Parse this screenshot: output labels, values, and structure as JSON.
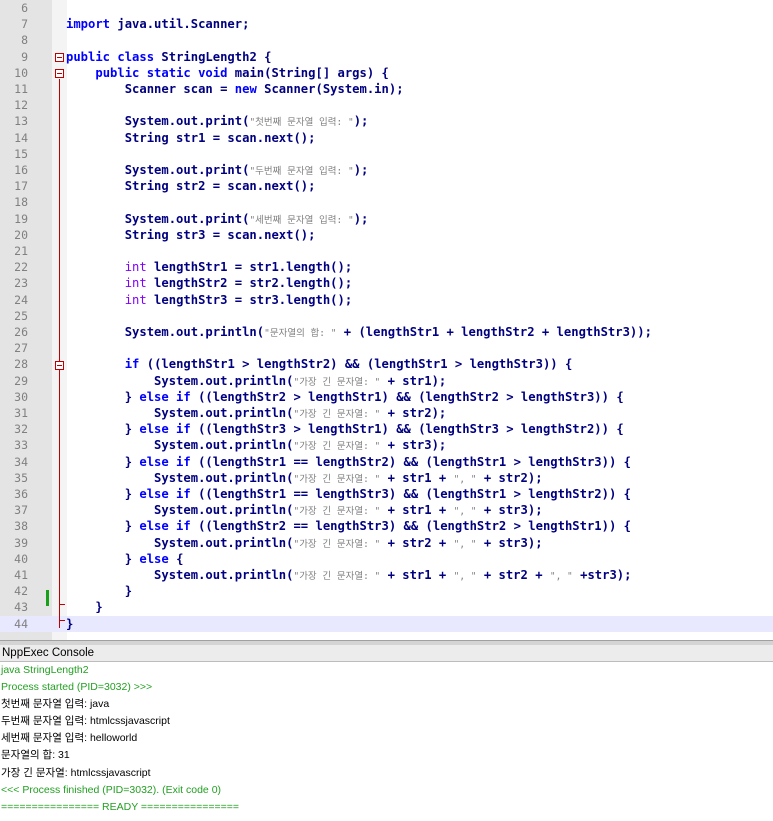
{
  "editor": {
    "lines": [
      {
        "num": "6",
        "segs": []
      },
      {
        "num": "7",
        "segs": [
          {
            "c": "kw",
            "t": "import"
          },
          {
            "c": "",
            "t": " java.util.Scanner;"
          }
        ]
      },
      {
        "num": "8",
        "segs": []
      },
      {
        "num": "9",
        "segs": [
          {
            "c": "kw",
            "t": "public class"
          },
          {
            "c": "",
            "t": " StringLength2 {"
          }
        ]
      },
      {
        "num": "10",
        "segs": [
          {
            "c": "",
            "t": "    "
          },
          {
            "c": "kw",
            "t": "public static void"
          },
          {
            "c": "",
            "t": " main(String[] args) {"
          }
        ]
      },
      {
        "num": "11",
        "segs": [
          {
            "c": "",
            "t": "        Scanner scan = "
          },
          {
            "c": "kw",
            "t": "new"
          },
          {
            "c": "",
            "t": " Scanner(System.in);"
          }
        ]
      },
      {
        "num": "12",
        "segs": []
      },
      {
        "num": "13",
        "segs": [
          {
            "c": "",
            "t": "        System.out.print("
          },
          {
            "c": "str",
            "t": "\"첫번째 문자열 입력: \""
          },
          {
            "c": "",
            "t": ");"
          }
        ]
      },
      {
        "num": "14",
        "segs": [
          {
            "c": "",
            "t": "        String str1 = scan.next();"
          }
        ]
      },
      {
        "num": "15",
        "segs": []
      },
      {
        "num": "16",
        "segs": [
          {
            "c": "",
            "t": "        System.out.print("
          },
          {
            "c": "str",
            "t": "\"두번째 문자열 입력: \""
          },
          {
            "c": "",
            "t": ");"
          }
        ]
      },
      {
        "num": "17",
        "segs": [
          {
            "c": "",
            "t": "        String str2 = scan.next();"
          }
        ]
      },
      {
        "num": "18",
        "segs": []
      },
      {
        "num": "19",
        "segs": [
          {
            "c": "",
            "t": "        System.out.print("
          },
          {
            "c": "str",
            "t": "\"세번째 문자열 입력: \""
          },
          {
            "c": "",
            "t": ");"
          }
        ]
      },
      {
        "num": "20",
        "segs": [
          {
            "c": "",
            "t": "        String str3 = scan.next();"
          }
        ]
      },
      {
        "num": "21",
        "segs": []
      },
      {
        "num": "22",
        "segs": [
          {
            "c": "",
            "t": "        "
          },
          {
            "c": "ty",
            "t": "int"
          },
          {
            "c": "",
            "t": " lengthStr1 = str1.length();"
          }
        ]
      },
      {
        "num": "23",
        "segs": [
          {
            "c": "",
            "t": "        "
          },
          {
            "c": "ty",
            "t": "int"
          },
          {
            "c": "",
            "t": " lengthStr2 = str2.length();"
          }
        ]
      },
      {
        "num": "24",
        "segs": [
          {
            "c": "",
            "t": "        "
          },
          {
            "c": "ty",
            "t": "int"
          },
          {
            "c": "",
            "t": " lengthStr3 = str3.length();"
          }
        ]
      },
      {
        "num": "25",
        "segs": []
      },
      {
        "num": "26",
        "segs": [
          {
            "c": "",
            "t": "        System.out.println("
          },
          {
            "c": "str",
            "t": "\"문자열의 합: \""
          },
          {
            "c": "",
            "t": " + (lengthStr1 + lengthStr2 + lengthStr3));"
          }
        ]
      },
      {
        "num": "27",
        "segs": []
      },
      {
        "num": "28",
        "segs": [
          {
            "c": "",
            "t": "        "
          },
          {
            "c": "kw",
            "t": "if"
          },
          {
            "c": "",
            "t": " ((lengthStr1 > lengthStr2) && (lengthStr1 > lengthStr3)) {"
          }
        ]
      },
      {
        "num": "29",
        "segs": [
          {
            "c": "",
            "t": "            System.out.println("
          },
          {
            "c": "str",
            "t": "\"가장 긴 문자열: \""
          },
          {
            "c": "",
            "t": " + str1);"
          }
        ]
      },
      {
        "num": "30",
        "segs": [
          {
            "c": "",
            "t": "        } "
          },
          {
            "c": "kw",
            "t": "else if"
          },
          {
            "c": "",
            "t": " ((lengthStr2 > lengthStr1) && (lengthStr2 > lengthStr3)) {"
          }
        ]
      },
      {
        "num": "31",
        "segs": [
          {
            "c": "",
            "t": "            System.out.println("
          },
          {
            "c": "str",
            "t": "\"가장 긴 문자열: \""
          },
          {
            "c": "",
            "t": " + str2);"
          }
        ]
      },
      {
        "num": "32",
        "segs": [
          {
            "c": "",
            "t": "        } "
          },
          {
            "c": "kw",
            "t": "else if"
          },
          {
            "c": "",
            "t": " ((lengthStr3 > lengthStr1) && (lengthStr3 > lengthStr2)) {"
          }
        ]
      },
      {
        "num": "33",
        "segs": [
          {
            "c": "",
            "t": "            System.out.println("
          },
          {
            "c": "str",
            "t": "\"가장 긴 문자열: \""
          },
          {
            "c": "",
            "t": " + str3);"
          }
        ]
      },
      {
        "num": "34",
        "segs": [
          {
            "c": "",
            "t": "        } "
          },
          {
            "c": "kw",
            "t": "else if"
          },
          {
            "c": "",
            "t": " ((lengthStr1 == lengthStr2) && (lengthStr1 > lengthStr3)) {"
          }
        ]
      },
      {
        "num": "35",
        "segs": [
          {
            "c": "",
            "t": "            System.out.println("
          },
          {
            "c": "str",
            "t": "\"가장 긴 문자열: \""
          },
          {
            "c": "",
            "t": " + str1 + "
          },
          {
            "c": "str",
            "t": "\", \""
          },
          {
            "c": "",
            "t": " + str2);"
          }
        ]
      },
      {
        "num": "36",
        "segs": [
          {
            "c": "",
            "t": "        } "
          },
          {
            "c": "kw",
            "t": "else if"
          },
          {
            "c": "",
            "t": " ((lengthStr1 == lengthStr3) && (lengthStr1 > lengthStr2)) {"
          }
        ]
      },
      {
        "num": "37",
        "segs": [
          {
            "c": "",
            "t": "            System.out.println("
          },
          {
            "c": "str",
            "t": "\"가장 긴 문자열: \""
          },
          {
            "c": "",
            "t": " + str1 + "
          },
          {
            "c": "str",
            "t": "\", \""
          },
          {
            "c": "",
            "t": " + str3);"
          }
        ]
      },
      {
        "num": "38",
        "segs": [
          {
            "c": "",
            "t": "        } "
          },
          {
            "c": "kw",
            "t": "else if"
          },
          {
            "c": "",
            "t": " ((lengthStr2 == lengthStr3) && (lengthStr2 > lengthStr1)) {"
          }
        ]
      },
      {
        "num": "39",
        "segs": [
          {
            "c": "",
            "t": "            System.out.println("
          },
          {
            "c": "str",
            "t": "\"가장 긴 문자열: \""
          },
          {
            "c": "",
            "t": " + str2 + "
          },
          {
            "c": "str",
            "t": "\", \""
          },
          {
            "c": "",
            "t": " + str3);"
          }
        ]
      },
      {
        "num": "40",
        "segs": [
          {
            "c": "",
            "t": "        } "
          },
          {
            "c": "kw",
            "t": "else"
          },
          {
            "c": "",
            "t": " {"
          }
        ]
      },
      {
        "num": "41",
        "segs": [
          {
            "c": "",
            "t": "            System.out.println("
          },
          {
            "c": "str",
            "t": "\"가장 긴 문자열: \""
          },
          {
            "c": "",
            "t": " + str1 + "
          },
          {
            "c": "str",
            "t": "\", \""
          },
          {
            "c": "",
            "t": " + str2 + "
          },
          {
            "c": "str",
            "t": "\", \""
          },
          {
            "c": "",
            "t": " +str3);"
          }
        ]
      },
      {
        "num": "42",
        "segs": [
          {
            "c": "",
            "t": "        }"
          }
        ]
      },
      {
        "num": "43",
        "segs": [
          {
            "c": "",
            "t": "    }"
          }
        ]
      },
      {
        "num": "44",
        "segs": [
          {
            "c": "",
            "t": "}"
          }
        ]
      }
    ],
    "current_line": "44"
  },
  "console": {
    "title": "NppExec Console",
    "lines": [
      {
        "t": "java StringLength2",
        "sys": true
      },
      {
        "t": "Process started (PID=3032) >>>",
        "sys": true
      },
      {
        "t": "첫번째 문자열 입력: java",
        "sys": false
      },
      {
        "t": "두번째 문자열 입력: htmlcssjavascript",
        "sys": false
      },
      {
        "t": "세번째 문자열 입력: helloworld",
        "sys": false
      },
      {
        "t": "문자열의 합: 31",
        "sys": false
      },
      {
        "t": "가장 긴 문자열: htmlcssjavascript",
        "sys": false
      },
      {
        "t": "<<< Process finished (PID=3032). (Exit code 0)",
        "sys": true
      },
      {
        "t": "================ READY ================",
        "sys": true
      }
    ]
  },
  "colors": {
    "keyword": "#0000ff",
    "type": "#8000ff",
    "operator": "#000080",
    "string": "#808080",
    "console_system": "#22a022",
    "fold_marker": "#c00000",
    "change_marker": "#18a018"
  },
  "icons": [
    "fold-minus-icon",
    "change-marker-icon"
  ]
}
